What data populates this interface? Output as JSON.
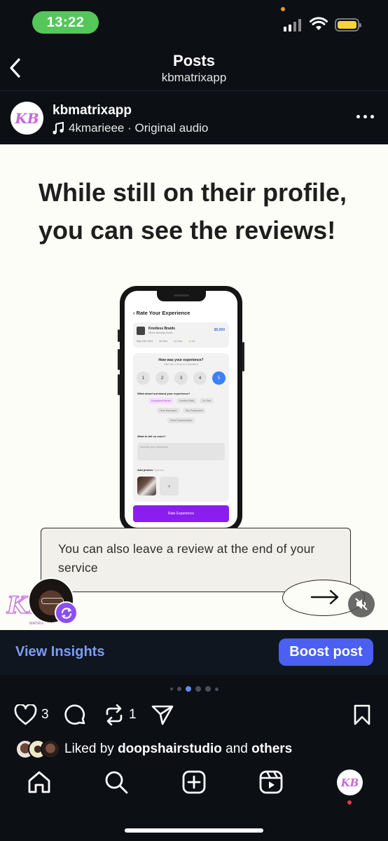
{
  "status_bar": {
    "time": "13:22",
    "battery_color": "#f6d33c",
    "time_pill_color": "#55c65a"
  },
  "header": {
    "title": "Posts",
    "subtitle": "kbmatrixapp"
  },
  "author": {
    "username": "kbmatrixapp",
    "audio": "4kmarieee · Original audio",
    "avatar_text": "KB"
  },
  "post": {
    "heading": "While still on their profile, you can see the reviews!",
    "caption": "You can also leave a review at the end of your service",
    "screen": {
      "title": "Rate Your Experience",
      "service_name": "Knotless Braids",
      "studio": "Mimi's Braiding Studio",
      "price": "$5,000",
      "date": "May 12th 2024",
      "duration": "3h 20m",
      "distance": "12.2 km",
      "rating": "4.8",
      "question": "How was your experience?",
      "question_sub": "Rate from 1 (Poor) to 5 (Excellent)",
      "scale": [
        "1",
        "2",
        "3",
        "4",
        "5"
      ],
      "selected_score": "5",
      "stood_out_label": "What stood out about your experience?",
      "options_row1": [
        "Exceptional Service",
        "Excellent Skills",
        "On Time"
      ],
      "options_row2": [
        "Clean Workspace",
        "Very Professional"
      ],
      "options_row3": [
        "Great Communication"
      ],
      "tell_label": "Want to tell us more?",
      "tell_placeholder": "Describe your experience",
      "photos_label": "Add photos",
      "photos_optional": "Optional",
      "plus": "+",
      "button": "Rate Experience"
    },
    "logo_text": "KB",
    "logo_sub": "MATRIX"
  },
  "insights": {
    "view_insights": "View Insights",
    "boost": "Boost post",
    "boost_color": "#4b5ff3"
  },
  "carousel": {
    "total": 6,
    "active_index": 2
  },
  "actions": {
    "likes": "3",
    "reposts": "1"
  },
  "liked_by": {
    "prefix": "Liked by",
    "user": "doopshairstudio",
    "middle": "and",
    "suffix": "others"
  },
  "tabbar": {
    "items": [
      "home-icon",
      "search-icon",
      "create-icon",
      "reels-icon",
      "profile-avatar"
    ],
    "profile_text": "KB"
  }
}
